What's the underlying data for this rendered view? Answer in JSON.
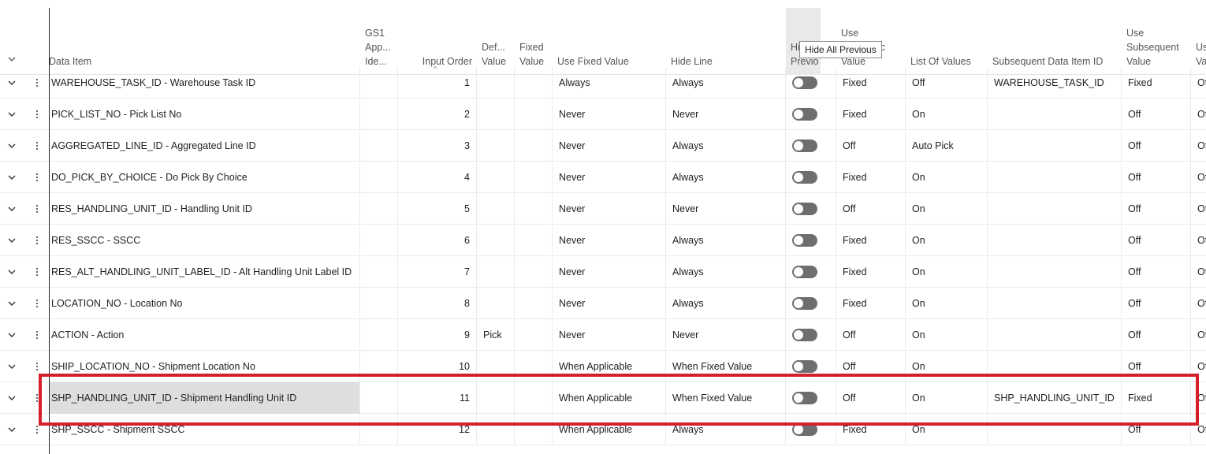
{
  "headers": {
    "data_item": "Data Item",
    "gs1": [
      "GS1",
      "App...",
      "Ide..."
    ],
    "input_order": "Input Order",
    "default_value": [
      "Def...",
      "Value"
    ],
    "fixed_value": [
      "Fixed",
      "Value"
    ],
    "use_fixed_value": "Use Fixed Value",
    "hide_line": "Hide Line",
    "hide_previous": [
      "Hi",
      "Previo"
    ],
    "use_fixed_value_short": [
      "Use",
      "c",
      "Value"
    ],
    "list_of_values": "List Of Values",
    "subsequent_data_item_id": "Subsequent Data Item ID",
    "use_subsequent_value": [
      "Use",
      "Subsequent",
      "Value"
    ],
    "last": [
      "Us",
      "Va"
    ]
  },
  "tooltip": "Hide All Previous",
  "rows": [
    {
      "item": "WAREHOUSE_TASK_ID - Warehouse Task ID",
      "order": "1",
      "def": "",
      "use_fixed": "Always",
      "hide_line": "Always",
      "use_fixed2": "Fixed",
      "lov": "Off",
      "subsequent": "WAREHOUSE_TASK_ID",
      "use_sub": "Fixed",
      "last": "Of"
    },
    {
      "item": "PICK_LIST_NO - Pick List No",
      "order": "2",
      "def": "",
      "use_fixed": "Never",
      "hide_line": "Never",
      "use_fixed2": "Fixed",
      "lov": "On",
      "subsequent": "",
      "use_sub": "Off",
      "last": "Of"
    },
    {
      "item": "AGGREGATED_LINE_ID - Aggregated Line ID",
      "order": "3",
      "def": "",
      "use_fixed": "Never",
      "hide_line": "Always",
      "use_fixed2": "Off",
      "lov": "Auto Pick",
      "subsequent": "",
      "use_sub": "Off",
      "last": "Of"
    },
    {
      "item": "DO_PICK_BY_CHOICE - Do Pick By Choice",
      "order": "4",
      "def": "",
      "use_fixed": "Never",
      "hide_line": "Always",
      "use_fixed2": "Fixed",
      "lov": "On",
      "subsequent": "",
      "use_sub": "Off",
      "last": "Of"
    },
    {
      "item": "RES_HANDLING_UNIT_ID - Handling Unit ID",
      "order": "5",
      "def": "",
      "use_fixed": "Never",
      "hide_line": "Never",
      "use_fixed2": "Off",
      "lov": "On",
      "subsequent": "",
      "use_sub": "Off",
      "last": "Of"
    },
    {
      "item": "RES_SSCC - SSCC",
      "order": "6",
      "def": "",
      "use_fixed": "Never",
      "hide_line": "Always",
      "use_fixed2": "Fixed",
      "lov": "On",
      "subsequent": "",
      "use_sub": "Off",
      "last": "Of"
    },
    {
      "item": "RES_ALT_HANDLING_UNIT_LABEL_ID - Alt Handling Unit Label ID",
      "order": "7",
      "def": "",
      "use_fixed": "Never",
      "hide_line": "Always",
      "use_fixed2": "Fixed",
      "lov": "On",
      "subsequent": "",
      "use_sub": "Off",
      "last": "Of"
    },
    {
      "item": "LOCATION_NO - Location No",
      "order": "8",
      "def": "",
      "use_fixed": "Never",
      "hide_line": "Always",
      "use_fixed2": "Fixed",
      "lov": "On",
      "subsequent": "",
      "use_sub": "Off",
      "last": "Of"
    },
    {
      "item": "ACTION - Action",
      "order": "9",
      "def": "Pick",
      "use_fixed": "Never",
      "hide_line": "Never",
      "use_fixed2": "Off",
      "lov": "On",
      "subsequent": "",
      "use_sub": "Off",
      "last": "Of"
    },
    {
      "item": "SHIP_LOCATION_NO - Shipment Location No",
      "order": "10",
      "def": "",
      "use_fixed": "When Applicable",
      "hide_line": "When Fixed Value",
      "use_fixed2": "Off",
      "lov": "On",
      "subsequent": "",
      "use_sub": "Off",
      "last": "Of"
    },
    {
      "item": "SHP_HANDLING_UNIT_ID - Shipment Handling Unit ID",
      "order": "11",
      "def": "",
      "use_fixed": "When Applicable",
      "hide_line": "When Fixed Value",
      "use_fixed2": "Off",
      "lov": "On",
      "subsequent": "SHP_HANDLING_UNIT_ID",
      "use_sub": "Fixed",
      "last": "Of"
    },
    {
      "item": "SHP_SSCC - Shipment SSCC",
      "order": "12",
      "def": "",
      "use_fixed": "When Applicable",
      "hide_line": "Always",
      "use_fixed2": "Fixed",
      "lov": "On",
      "subsequent": "",
      "use_sub": "Off",
      "last": "Of"
    }
  ],
  "selected_row": 10,
  "colors": {
    "highlight": "#d4202a",
    "toggle_off": "#6e6e6e",
    "selected_bg": "#dedede"
  }
}
